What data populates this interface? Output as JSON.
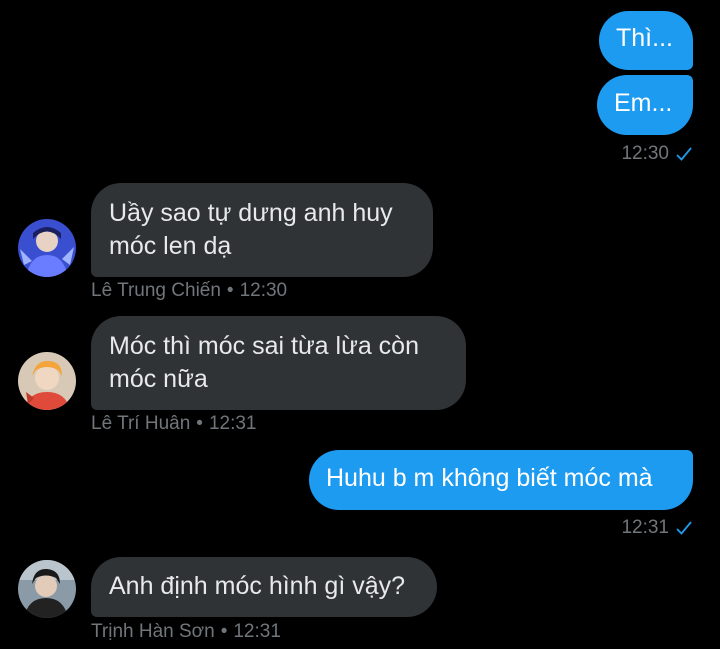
{
  "messages": [
    {
      "direction": "out",
      "text": "Thì..."
    },
    {
      "direction": "out",
      "text": "Em..."
    },
    {
      "direction": "out_meta",
      "time": "12:30"
    },
    {
      "direction": "in",
      "lines": [
        "Uầy sao tự dưng anh huy",
        "móc len dạ"
      ],
      "sender": "Lê Trung Chiến",
      "time": "12:30",
      "avatar": "avatar-blue"
    },
    {
      "direction": "in",
      "lines": [
        "Móc thì móc sai từa lừa còn",
        "móc nữa"
      ],
      "sender": "Lê Trí Huân",
      "time": "12:31",
      "avatar": "avatar-orange"
    },
    {
      "direction": "out",
      "text": "Huhu b m không biết móc mà"
    },
    {
      "direction": "out_meta",
      "time": "12:31"
    },
    {
      "direction": "in",
      "lines": [
        "Anh định móc hình gì vậy?"
      ],
      "sender": "Trịnh Hàn Sơn",
      "time": "12:31",
      "avatar": "avatar-dark"
    }
  ],
  "separator": "•",
  "icons": {
    "read_receipt": "check-icon"
  },
  "colors": {
    "background": "#000000",
    "outgoing_bubble": "#1d9bf0",
    "incoming_bubble": "#2f3336",
    "meta_text": "#71767b",
    "check": "#1d9bf0"
  }
}
